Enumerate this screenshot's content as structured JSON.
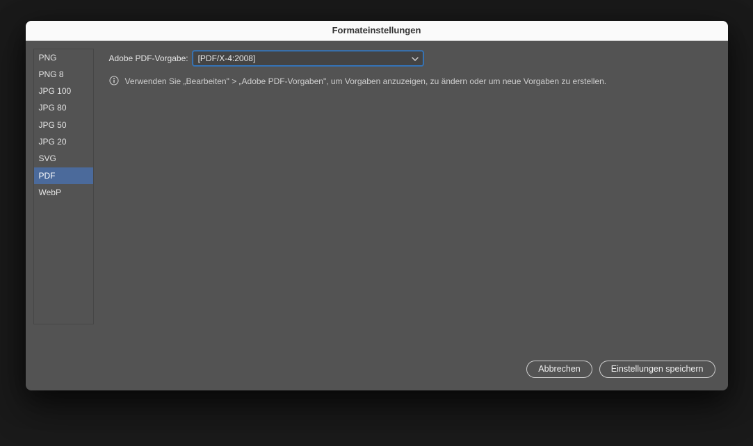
{
  "title": "Formateinstellungen",
  "sidebar": {
    "items": [
      {
        "label": "PNG"
      },
      {
        "label": "PNG 8"
      },
      {
        "label": "JPG 100"
      },
      {
        "label": "JPG 80"
      },
      {
        "label": "JPG 50"
      },
      {
        "label": "JPG 20"
      },
      {
        "label": "SVG"
      },
      {
        "label": "PDF"
      },
      {
        "label": "WebP"
      }
    ],
    "selectedIndex": 7
  },
  "main": {
    "presetLabel": "Adobe PDF-Vorgabe:",
    "presetValue": "[PDF/X-4:2008]",
    "infoText": "Verwenden Sie „Bearbeiten\" > „Adobe PDF-Vorgaben\", um Vorgaben anzuzeigen, zu ändern oder um neue Vorgaben zu erstellen."
  },
  "footer": {
    "cancelLabel": "Abbrechen",
    "saveLabel": "Einstellungen speichern"
  }
}
